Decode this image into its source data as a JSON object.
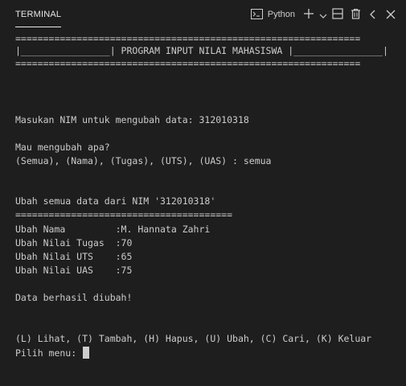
{
  "panel": {
    "tab_label": "TERMINAL",
    "shell_label": "Python"
  },
  "toolbar": {
    "icons": [
      "terminal-icon",
      "plus-icon",
      "chevron-down-icon",
      "split-icon",
      "trash-icon",
      "chevron-left-icon",
      "close-icon"
    ]
  },
  "terminal": {
    "lines": [
      "==============================================================",
      "|________________| PROGRAM INPUT NILAI MAHASISWA |________________|",
      "==============================================================",
      "Masukan NIM untuk mengubah data: 312010318",
      "Mau mengubah apa?",
      "(Semua), (Nama), (Tugas), (UTS), (UAS) : semua",
      "Ubah semua data dari NIM '312010318'",
      "=======================================",
      "Ubah Nama         :M. Hannata Zahri",
      "Ubah Nilai Tugas  :70",
      "Ubah Nilai UTS    :65",
      "Ubah Nilai UAS    :75",
      "Data berhasil diubah!",
      "(L) Lihat, (T) Tambah, (H) Hapus, (U) Ubah, (C) Cari, (K) Keluar",
      "Pilih menu: "
    ]
  },
  "colors": {
    "background": "#1e1e1e",
    "foreground": "#cccccc",
    "tab_active": "#e7e7e7"
  }
}
